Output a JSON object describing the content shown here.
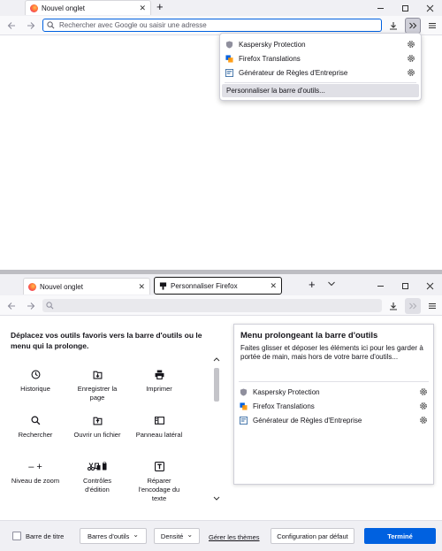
{
  "top_window": {
    "tab_title": "Nouvel onglet",
    "new_tab_glyph": "+",
    "address_placeholder": "Rechercher avec Google ou saisir une adresse",
    "overflow_menu": {
      "items": [
        {
          "label": "Kaspersky Protection",
          "icon": "kaspersky-shield-icon"
        },
        {
          "label": "Firefox Translations",
          "icon": "translate-icon"
        },
        {
          "label": "Générateur de Règles d'Entreprise",
          "icon": "policy-generator-icon"
        }
      ],
      "customize_label": "Personnaliser la barre d'outils..."
    }
  },
  "bottom_window": {
    "tabs": [
      {
        "title": "Nouvel onglet",
        "icon": "firefox-icon"
      },
      {
        "title": "Personnaliser Firefox",
        "icon": "customize-icon"
      }
    ],
    "new_tab_glyph": "+",
    "palette_heading": "Déplacez vos outils favoris vers la barre d'outils ou le menu qui la prolonge.",
    "tools": [
      {
        "label": "Historique",
        "icon": "clock-icon"
      },
      {
        "label": "Enregistrer la page",
        "icon": "save-page-icon"
      },
      {
        "label": "Imprimer",
        "icon": "printer-icon"
      },
      {
        "label": "Rechercher",
        "icon": "search-icon"
      },
      {
        "label": "Ouvrir un fichier",
        "icon": "open-file-icon"
      },
      {
        "label": "Panneau latéral",
        "icon": "sidebar-icon"
      },
      {
        "label": "Niveau de zoom",
        "icon": "zoom-icon",
        "glyph": "– +"
      },
      {
        "label": "Contrôles d'édition",
        "icon": "edit-controls-icon"
      },
      {
        "label": "Réparer l'encodage du texte",
        "icon": "text-encoding-icon"
      }
    ],
    "overflow_panel": {
      "title": "Menu prolongeant la barre d'outils",
      "description": "Faites glisser et déposer les éléments ici pour les garder à portée de main, mais hors de votre barre d'outils...",
      "items": [
        {
          "label": "Kaspersky Protection",
          "icon": "kaspersky-shield-icon"
        },
        {
          "label": "Firefox Translations",
          "icon": "translate-icon"
        },
        {
          "label": "Générateur de Règles d'Entreprise",
          "icon": "policy-generator-icon"
        }
      ]
    },
    "footer": {
      "title_bar_label": "Barre de titre",
      "toolbars_label": "Barres d'outils",
      "density_label": "Densité",
      "manage_themes_label": "Gérer les thèmes",
      "restore_defaults_label": "Configuration par défaut",
      "done_label": "Terminé"
    }
  },
  "colors": {
    "accent": "#0061e0",
    "popup_highlight": "#e0e0e6",
    "chrome_bg": "#f0f0f4",
    "separator": "#bdbdc2"
  }
}
